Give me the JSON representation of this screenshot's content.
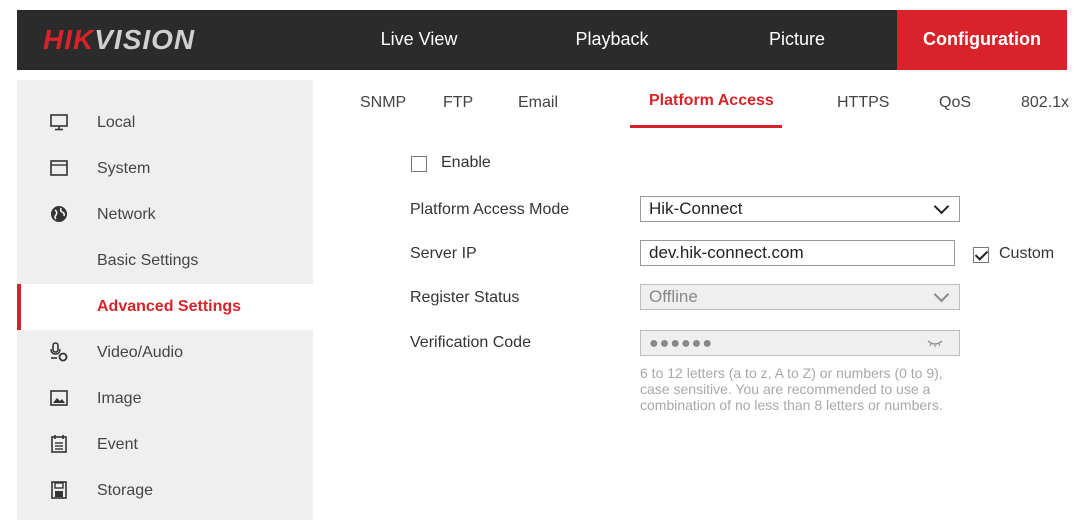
{
  "brand": {
    "logo_red": "HIK",
    "logo_gray": "VISION"
  },
  "topnav": [
    {
      "label": "Live View"
    },
    {
      "label": "Playback"
    },
    {
      "label": "Picture"
    },
    {
      "label": "Configuration",
      "active": true
    }
  ],
  "sidebar": {
    "items": [
      {
        "label": "Local",
        "icon": "monitor-icon"
      },
      {
        "label": "System",
        "icon": "window-icon"
      },
      {
        "label": "Network",
        "icon": "globe-icon"
      },
      {
        "label": "Basic Settings",
        "sub": true
      },
      {
        "label": "Advanced Settings",
        "sub": true,
        "active": true
      },
      {
        "label": "Video/Audio",
        "icon": "mic-camera-icon"
      },
      {
        "label": "Image",
        "icon": "image-icon"
      },
      {
        "label": "Event",
        "icon": "calendar-icon"
      },
      {
        "label": "Storage",
        "icon": "save-icon"
      }
    ]
  },
  "tabs": [
    {
      "label": "SNMP"
    },
    {
      "label": "FTP"
    },
    {
      "label": "Email"
    },
    {
      "label": "Platform Access",
      "active": true
    },
    {
      "label": "HTTPS"
    },
    {
      "label": "QoS"
    },
    {
      "label": "802.1x"
    }
  ],
  "form": {
    "enable": {
      "label": "Enable",
      "checked": false
    },
    "mode": {
      "label": "Platform Access Mode",
      "value": "Hik-Connect"
    },
    "server_ip": {
      "label": "Server IP",
      "value": "dev.hik-connect.com",
      "custom_label": "Custom",
      "custom_checked": true
    },
    "register_status": {
      "label": "Register Status",
      "value": "Offline"
    },
    "verification": {
      "label": "Verification Code",
      "value": "●●●●●●",
      "hint": "6 to 12 letters (a to z, A to Z) or numbers (0 to 9), case sensitive. You are recommended to use a combination of no less than 8 letters or numbers."
    }
  },
  "colors": {
    "accent": "#d9232a",
    "topbar": "#2b2b2b",
    "sidebar": "#efefef"
  }
}
